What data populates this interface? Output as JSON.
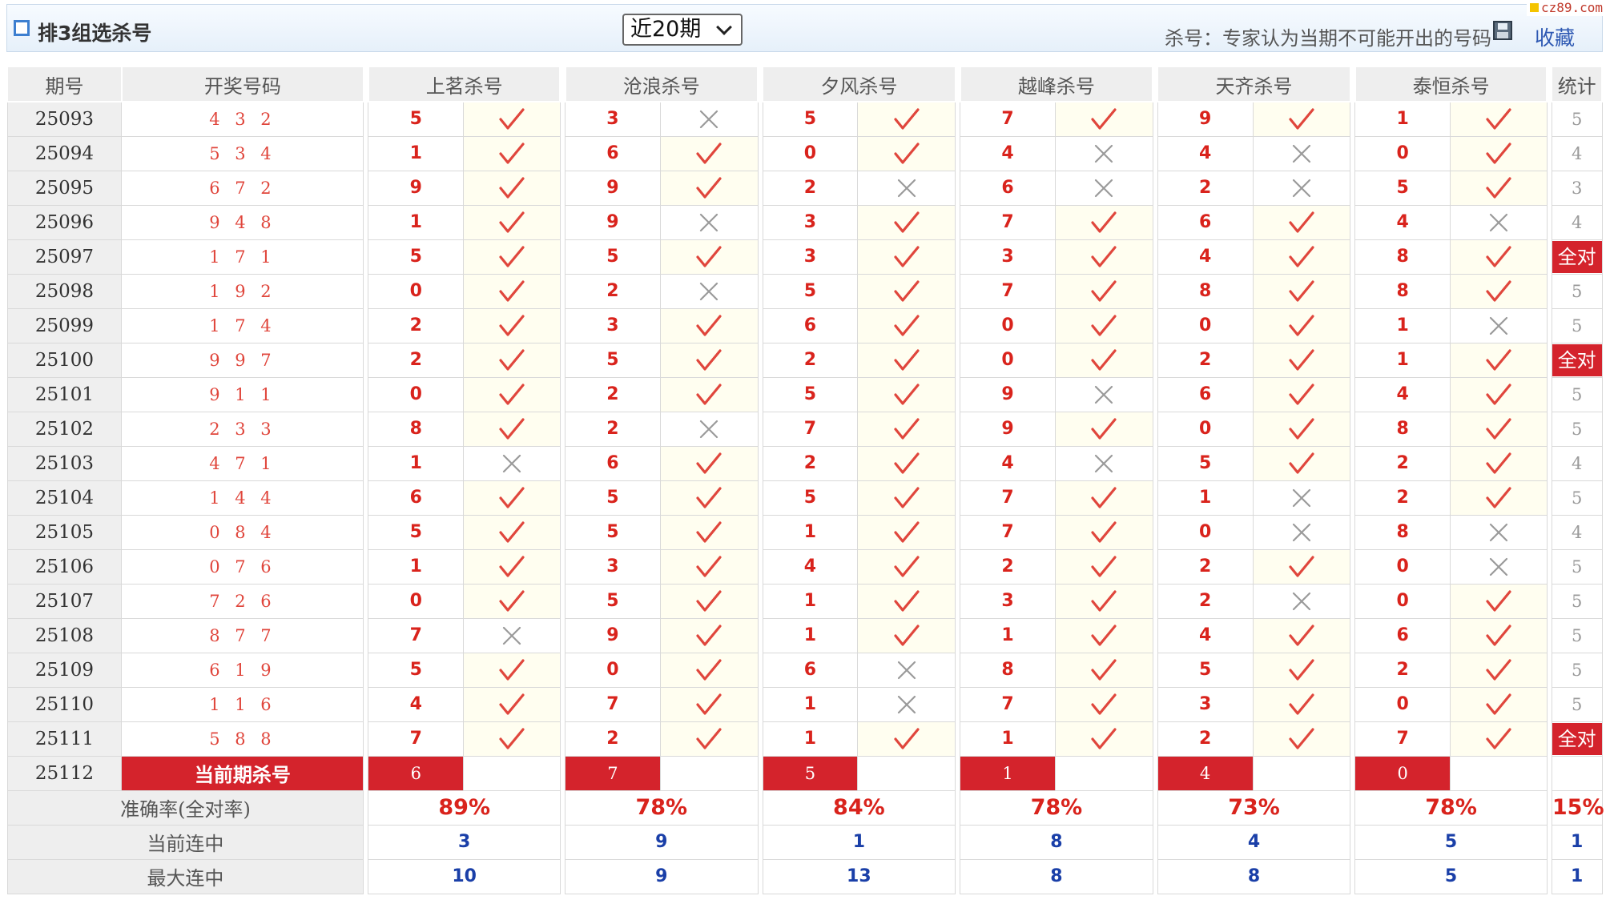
{
  "header": {
    "title": "排3组选杀号",
    "period_select": "近20期",
    "kill_note": "杀号：专家认为当期不可能开出的号码",
    "save_label": "收藏",
    "site_badge": "cz89.com"
  },
  "columns": {
    "period": "期号",
    "draw": "开奖号码",
    "experts": [
      "上茗杀号",
      "沧浪杀号",
      "夕风杀号",
      "越峰杀号",
      "天齐杀号",
      "泰恒杀号"
    ],
    "stat": "统计"
  },
  "rows": [
    {
      "period": "25093",
      "draw": "4 3 2",
      "kills": [
        "5",
        "3",
        "5",
        "7",
        "9",
        "1"
      ],
      "ok": [
        true,
        false,
        true,
        true,
        true,
        true
      ],
      "stat": "5"
    },
    {
      "period": "25094",
      "draw": "5 3 4",
      "kills": [
        "1",
        "6",
        "0",
        "4",
        "4",
        "0"
      ],
      "ok": [
        true,
        true,
        true,
        false,
        false,
        true
      ],
      "stat": "4"
    },
    {
      "period": "25095",
      "draw": "6 7 2",
      "kills": [
        "9",
        "9",
        "2",
        "6",
        "2",
        "5"
      ],
      "ok": [
        true,
        true,
        false,
        false,
        false,
        true
      ],
      "stat": "3"
    },
    {
      "period": "25096",
      "draw": "9 4 8",
      "kills": [
        "1",
        "9",
        "3",
        "7",
        "6",
        "4"
      ],
      "ok": [
        true,
        false,
        true,
        true,
        true,
        false
      ],
      "stat": "4"
    },
    {
      "period": "25097",
      "draw": "1 7 1",
      "kills": [
        "5",
        "5",
        "3",
        "3",
        "4",
        "8"
      ],
      "ok": [
        true,
        true,
        true,
        true,
        true,
        true
      ],
      "stat": "全对"
    },
    {
      "period": "25098",
      "draw": "1 9 2",
      "kills": [
        "0",
        "2",
        "5",
        "7",
        "8",
        "8"
      ],
      "ok": [
        true,
        false,
        true,
        true,
        true,
        true
      ],
      "stat": "5"
    },
    {
      "period": "25099",
      "draw": "1 7 4",
      "kills": [
        "2",
        "3",
        "6",
        "0",
        "0",
        "1"
      ],
      "ok": [
        true,
        true,
        true,
        true,
        true,
        false
      ],
      "stat": "5"
    },
    {
      "period": "25100",
      "draw": "9 9 7",
      "kills": [
        "2",
        "5",
        "2",
        "0",
        "2",
        "1"
      ],
      "ok": [
        true,
        true,
        true,
        true,
        true,
        true
      ],
      "stat": "全对"
    },
    {
      "period": "25101",
      "draw": "9 1 1",
      "kills": [
        "0",
        "2",
        "5",
        "9",
        "6",
        "4"
      ],
      "ok": [
        true,
        true,
        true,
        false,
        true,
        true
      ],
      "stat": "5"
    },
    {
      "period": "25102",
      "draw": "2 3 3",
      "kills": [
        "8",
        "2",
        "7",
        "9",
        "0",
        "8"
      ],
      "ok": [
        true,
        false,
        true,
        true,
        true,
        true
      ],
      "stat": "5"
    },
    {
      "period": "25103",
      "draw": "4 7 1",
      "kills": [
        "1",
        "6",
        "2",
        "4",
        "5",
        "2"
      ],
      "ok": [
        false,
        true,
        true,
        false,
        true,
        true
      ],
      "stat": "4"
    },
    {
      "period": "25104",
      "draw": "1 4 4",
      "kills": [
        "6",
        "5",
        "5",
        "7",
        "1",
        "2"
      ],
      "ok": [
        true,
        true,
        true,
        true,
        false,
        true
      ],
      "stat": "5"
    },
    {
      "period": "25105",
      "draw": "0 8 4",
      "kills": [
        "5",
        "5",
        "1",
        "7",
        "0",
        "8"
      ],
      "ok": [
        true,
        true,
        true,
        true,
        false,
        false
      ],
      "stat": "4"
    },
    {
      "period": "25106",
      "draw": "0 7 6",
      "kills": [
        "1",
        "3",
        "4",
        "2",
        "2",
        "0"
      ],
      "ok": [
        true,
        true,
        true,
        true,
        true,
        false
      ],
      "stat": "5"
    },
    {
      "period": "25107",
      "draw": "7 2 6",
      "kills": [
        "0",
        "5",
        "1",
        "3",
        "2",
        "0"
      ],
      "ok": [
        true,
        true,
        true,
        true,
        false,
        true
      ],
      "stat": "5"
    },
    {
      "period": "25108",
      "draw": "8 7 7",
      "kills": [
        "7",
        "9",
        "1",
        "1",
        "4",
        "6"
      ],
      "ok": [
        false,
        true,
        true,
        true,
        true,
        true
      ],
      "stat": "5"
    },
    {
      "period": "25109",
      "draw": "6 1 9",
      "kills": [
        "5",
        "0",
        "6",
        "8",
        "5",
        "2"
      ],
      "ok": [
        true,
        true,
        false,
        true,
        true,
        true
      ],
      "stat": "5"
    },
    {
      "period": "25110",
      "draw": "1 1 6",
      "kills": [
        "4",
        "7",
        "1",
        "7",
        "3",
        "0"
      ],
      "ok": [
        true,
        true,
        false,
        true,
        true,
        true
      ],
      "stat": "5"
    },
    {
      "period": "25111",
      "draw": "5 8 8",
      "kills": [
        "7",
        "2",
        "1",
        "1",
        "2",
        "7"
      ],
      "ok": [
        true,
        true,
        true,
        true,
        true,
        true
      ],
      "stat": "全对"
    }
  ],
  "current": {
    "period": "25112",
    "label": "当前期杀号",
    "kills": [
      "6",
      "7",
      "5",
      "1",
      "4",
      "0"
    ]
  },
  "footer": {
    "accuracy": {
      "label": "准确率(全对率)",
      "values": [
        "89%",
        "78%",
        "84%",
        "78%",
        "73%",
        "78%"
      ],
      "stat": "15%"
    },
    "current_streak": {
      "label": "当前连中",
      "values": [
        "3",
        "9",
        "1",
        "8",
        "4",
        "5"
      ],
      "stat": "1"
    },
    "max_streak": {
      "label": "最大连中",
      "values": [
        "10",
        "9",
        "13",
        "8",
        "8",
        "5"
      ],
      "stat": "1"
    }
  },
  "colors": {
    "accent_red": "#d4232c",
    "check_red": "#e0463c",
    "cross_gray": "#9a9a9a",
    "streak_blue": "#1a3fa8"
  }
}
